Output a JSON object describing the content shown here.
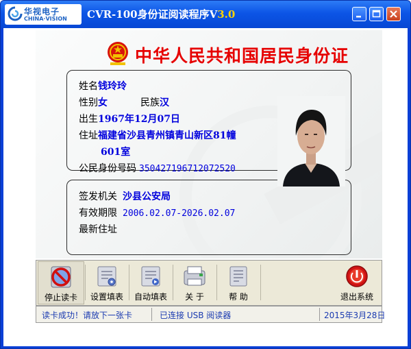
{
  "window": {
    "logo_cn": "华视电子",
    "logo_en": "CHINA·VISION",
    "title_main": "CVR-100身份证阅读程序V",
    "title_version": "3.0"
  },
  "card": {
    "header": "中华人民共和国居民身份证",
    "name_label": "姓名",
    "name": "钱玲玲",
    "sex_label": "性别",
    "sex": "女",
    "ethnic_label": "民族",
    "ethnic": "汉",
    "birth_label": "出生",
    "birth": "1967年12月07日",
    "address_label": "住址",
    "address_line1": "福建省沙县青州镇青山新区81幢",
    "address_line2": "601室",
    "id_label": "公民身份号码",
    "id_number": "350427196712072520",
    "issuer_label": "签发机关",
    "issuer": "沙县公安局",
    "validity_label": "有效期限",
    "validity": "2006.02.07-2026.02.07",
    "latest_address_label": "最新住址",
    "latest_address": ""
  },
  "toolbar": {
    "stop": "停止读卡",
    "settings": "设置填表",
    "autofill": "自动填表",
    "about": "关 于",
    "help": "帮 助",
    "exit": "退出系统"
  },
  "status": {
    "message": "读卡成功！请放下一张卡",
    "device": "已连接 USB 阅读器",
    "date": "2015年3月28日"
  },
  "colors": {
    "title_bar": "#0c55e6",
    "card_title": "#e60000",
    "value_text": "#0000dd",
    "status_text": "#1a3ab0",
    "version_text": "#ffd400"
  }
}
